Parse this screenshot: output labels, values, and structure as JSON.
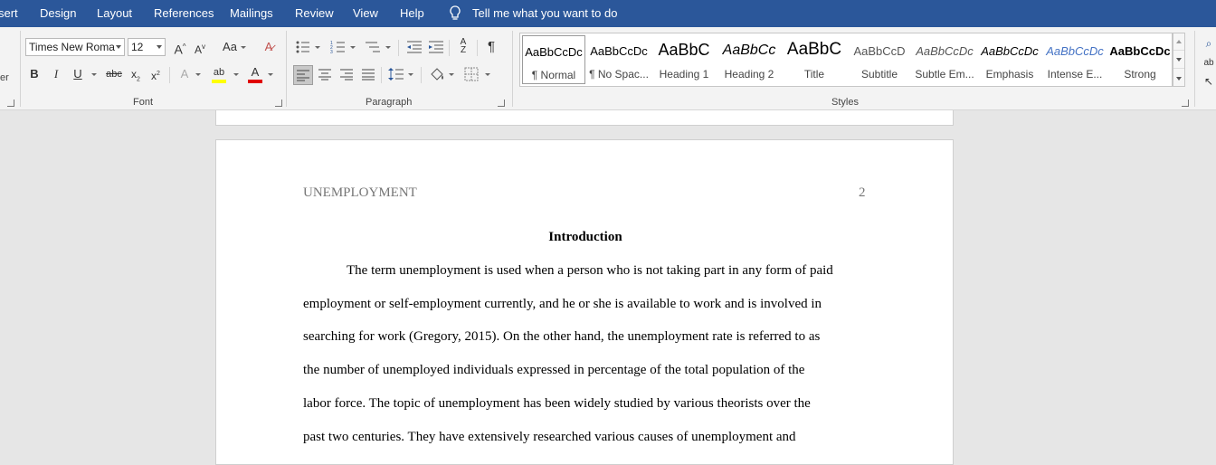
{
  "menubar": {
    "tabs": [
      "sert",
      "Design",
      "Layout",
      "References",
      "Mailings",
      "Review",
      "View",
      "Help"
    ],
    "tell_me": "Tell me what you want to do"
  },
  "ribbon": {
    "font": {
      "font_name": "Times New Roma",
      "font_size": "12",
      "group_label": "Font"
    },
    "paragraph": {
      "group_label": "Paragraph"
    },
    "styles": {
      "group_label": "Styles",
      "items": [
        {
          "preview": "AaBbCcDc",
          "name": "¶ Normal"
        },
        {
          "preview": "AaBbCcDc",
          "name": "¶ No Spac..."
        },
        {
          "preview": "AaBbC",
          "name": "Heading 1"
        },
        {
          "preview": "AaBbCc",
          "name": "Heading 2"
        },
        {
          "preview": "AaBbC",
          "name": "Title"
        },
        {
          "preview": "AaBbCcD",
          "name": "Subtitle"
        },
        {
          "preview": "AaBbCcDc",
          "name": "Subtle Em..."
        },
        {
          "preview": "AaBbCcDc",
          "name": "Emphasis"
        },
        {
          "preview": "AaBbCcDc",
          "name": "Intense E..."
        },
        {
          "preview": "AaBbCcDc",
          "name": "Strong"
        }
      ]
    }
  },
  "document": {
    "running_head": "UNEMPLOYMENT",
    "page_number": "2",
    "heading": "Introduction",
    "lines": [
      "The term unemployment is used when a person who is not taking part in any form of paid",
      "employment or self-employment currently, and he or she is available to work and is involved in",
      "searching for work (Gregory, 2015).  On the other hand, the unemployment rate is referred to as",
      "the number of unemployed individuals expressed in percentage of the total population of the",
      "labor force.  The topic of unemployment has been widely studied by various theorists over the",
      "past two centuries. They have extensively researched various causes of unemployment and"
    ]
  },
  "colors": {
    "menubar": "#2b579a",
    "ribbon": "#f3f3f3",
    "canvas": "#e6e6e6",
    "highlight_yellow": "#ffff00",
    "font_color_red": "#e00000"
  }
}
